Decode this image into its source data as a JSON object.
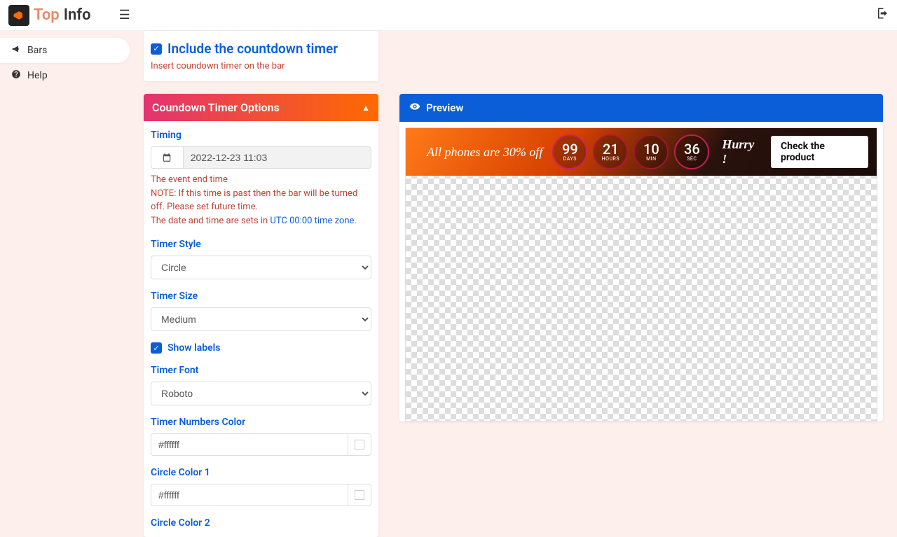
{
  "brand": {
    "top": "Top",
    "info": "Info"
  },
  "sidebar": {
    "items": [
      {
        "label": "Bars",
        "icon": "megaphone"
      },
      {
        "label": "Help",
        "icon": "question"
      }
    ]
  },
  "include": {
    "label": "Include the countdown timer",
    "desc": "Insert coundown timer on the bar",
    "checked": true
  },
  "panel": {
    "title": "Coundown Timer Options",
    "timing": {
      "label": "Timing",
      "value": "2022-12-23 11:03",
      "help1": "The event end time",
      "help2": "NOTE: If this time is past then the bar will be turned off. Please set future time.",
      "help3_pre": "The date and time are sets in ",
      "help3_link": "UTC 00:00 time zone",
      "help3_post": "."
    },
    "style": {
      "label": "Timer Style",
      "value": "Circle"
    },
    "size": {
      "label": "Timer Size",
      "value": "Medium"
    },
    "showLabels": {
      "label": "Show labels",
      "checked": true
    },
    "font": {
      "label": "Timer Font",
      "value": "Roboto"
    },
    "numColor": {
      "label": "Timer Numbers Color",
      "value": "#ffffff"
    },
    "circle1": {
      "label": "Circle Color 1",
      "value": "#ffffff"
    },
    "circle2": {
      "label": "Circle Color 2"
    }
  },
  "preview": {
    "title": "Preview",
    "bar": {
      "textLeft": "All phones are 30% off",
      "days": {
        "val": "99",
        "lbl": "DAYS"
      },
      "hours": {
        "val": "21",
        "lbl": "HOURS"
      },
      "min": {
        "val": "10",
        "lbl": "MIN"
      },
      "sec": {
        "val": "36",
        "lbl": "SEC"
      },
      "textMid": "Hurry !",
      "button": "Check the product"
    }
  }
}
